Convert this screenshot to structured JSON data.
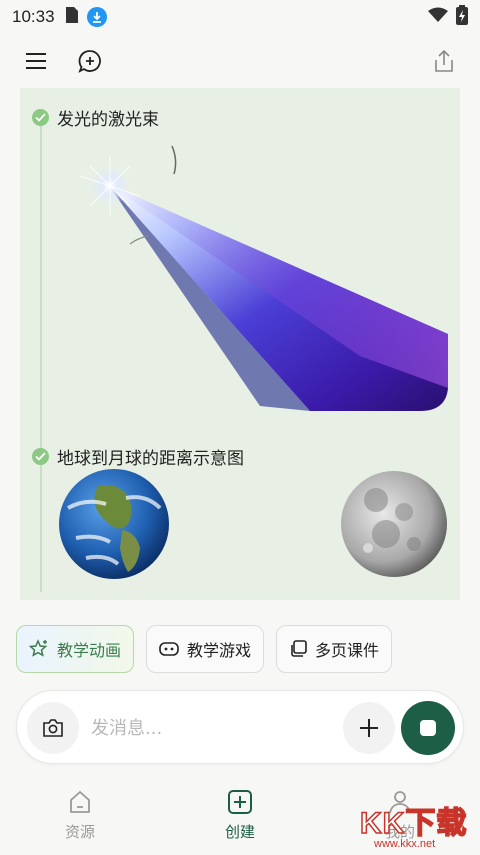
{
  "status_bar": {
    "time": "10:33",
    "icons": [
      "sim-card-icon",
      "download-icon",
      "wifi-icon",
      "battery-icon"
    ]
  },
  "toolbar": {
    "icons": [
      "menu-icon",
      "new-chat-icon",
      "share-icon"
    ]
  },
  "sections": [
    {
      "title": "发光的激光束",
      "image": "laser-beam"
    },
    {
      "title": "地球到月球的距离示意图",
      "images": [
        "earth",
        "moon"
      ]
    }
  ],
  "chips": [
    {
      "label": "教学动画",
      "icon": "sparkle-star-icon",
      "active": true
    },
    {
      "label": "教学游戏",
      "icon": "gamepad-icon",
      "active": false
    },
    {
      "label": "多页课件",
      "icon": "pages-icon",
      "active": false
    }
  ],
  "input": {
    "placeholder": "发消息..."
  },
  "bottom_nav": [
    {
      "label": "资源",
      "icon": "home-icon",
      "active": false
    },
    {
      "label": "创建",
      "icon": "create-icon",
      "active": true
    },
    {
      "label": "我的",
      "icon": "profile-icon",
      "active": false
    }
  ],
  "watermark": {
    "brand": "KK下载",
    "url": "www.kkx.net"
  },
  "colors": {
    "accent": "#1d5e46",
    "panel": "#e8f0e6",
    "check": "#8cc983",
    "download_badge": "#2196f3"
  }
}
